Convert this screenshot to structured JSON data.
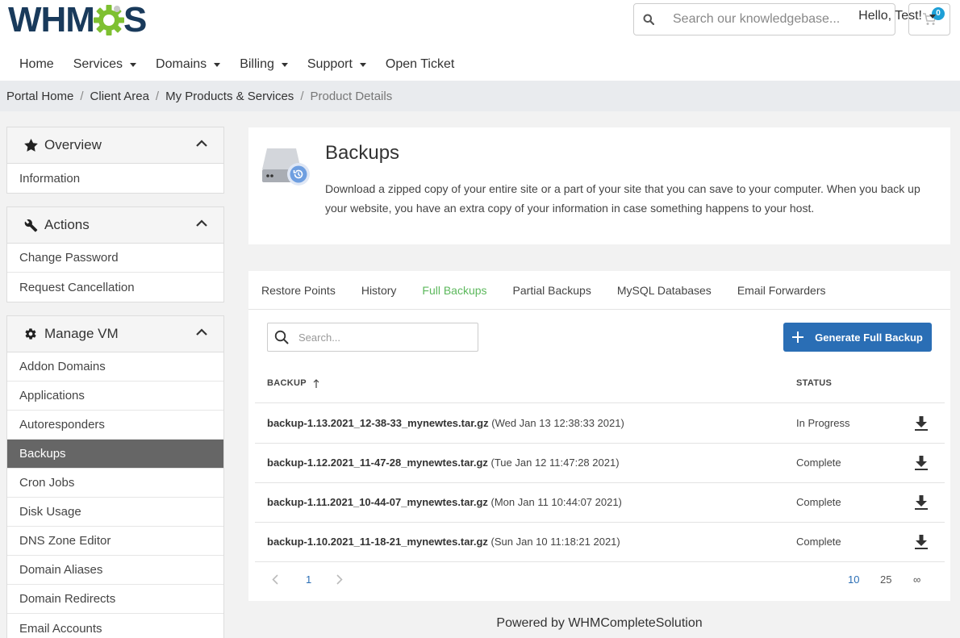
{
  "brand": {
    "logo_left": "WHM",
    "logo_right": "S"
  },
  "header": {
    "search_placeholder": "Search our knowledgebase...",
    "cart_count": "0"
  },
  "nav": {
    "items": [
      {
        "label": "Home",
        "dropdown": false
      },
      {
        "label": "Services",
        "dropdown": true
      },
      {
        "label": "Domains",
        "dropdown": true
      },
      {
        "label": "Billing",
        "dropdown": true
      },
      {
        "label": "Support",
        "dropdown": true
      },
      {
        "label": "Open Ticket",
        "dropdown": false
      }
    ],
    "user_greeting": "Hello, Test!"
  },
  "breadcrumb": [
    "Portal Home",
    "Client Area",
    "My Products & Services",
    "Product Details"
  ],
  "sidebar": {
    "overview": {
      "title": "Overview",
      "items": [
        "Information"
      ]
    },
    "actions": {
      "title": "Actions",
      "items": [
        "Change Password",
        "Request Cancellation"
      ]
    },
    "manage_vm": {
      "title": "Manage VM",
      "items": [
        "Addon Domains",
        "Applications",
        "Autoresponders",
        "Backups",
        "Cron Jobs",
        "Disk Usage",
        "DNS Zone Editor",
        "Domain Aliases",
        "Domain Redirects",
        "Email Accounts"
      ],
      "active": "Backups"
    }
  },
  "intro": {
    "title": "Backups",
    "description": "Download a zipped copy of your entire site or a part of your site that you can save to your computer. When you back up your website, you have an extra copy of your information in case something happens to your host."
  },
  "tabs": [
    "Restore Points",
    "History",
    "Full Backups",
    "Partial Backups",
    "MySQL Databases",
    "Email Forwarders"
  ],
  "active_tab": "Full Backups",
  "table": {
    "search_placeholder": "Search...",
    "generate_button": "Generate Full Backup",
    "columns": {
      "backup": "BACKUP",
      "status": "STATUS"
    },
    "rows": [
      {
        "file": "backup-1.13.2021_12-38-33_mynewtes.tar.gz",
        "date": "(Wed Jan 13 12:38:33 2021)",
        "status": "In Progress"
      },
      {
        "file": "backup-1.12.2021_11-47-28_mynewtes.tar.gz",
        "date": "(Tue Jan 12 11:47:28 2021)",
        "status": "Complete"
      },
      {
        "file": "backup-1.11.2021_10-44-07_mynewtes.tar.gz",
        "date": "(Mon Jan 11 10:44:07 2021)",
        "status": "Complete"
      },
      {
        "file": "backup-1.10.2021_11-18-21_mynewtes.tar.gz",
        "date": "(Sun Jan 10 11:18:21 2021)",
        "status": "Complete"
      }
    ]
  },
  "pagination": {
    "current_page": "1",
    "page_sizes": [
      "10",
      "25",
      "∞"
    ],
    "active_size": "10"
  },
  "footer": {
    "text": "Powered by WHMCompleteSolution"
  },
  "colors": {
    "brand": "#193a5b",
    "accent_green": "#5cb85c",
    "primary_blue": "#2a6eb5",
    "gear_green": "#7ec031"
  }
}
